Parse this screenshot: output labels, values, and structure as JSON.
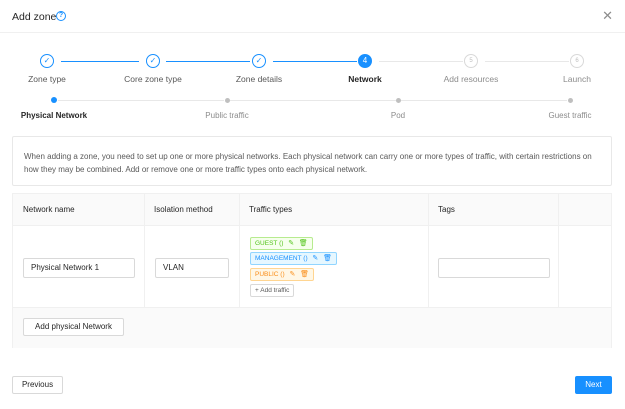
{
  "header": {
    "title": "Add zone",
    "help_icon": "question-circle-icon",
    "close_icon": "close-icon"
  },
  "steps": [
    {
      "label": "Zone type",
      "status": "done"
    },
    {
      "label": "Core zone type",
      "status": "done"
    },
    {
      "label": "Zone details",
      "status": "done"
    },
    {
      "label": "Network",
      "status": "active",
      "number": "4"
    },
    {
      "label": "Add resources",
      "status": "wait",
      "number": "5"
    },
    {
      "label": "Launch",
      "status": "wait",
      "number": "6"
    }
  ],
  "substeps": [
    {
      "label": "Physical Network",
      "status": "active"
    },
    {
      "label": "Public traffic",
      "status": "wait"
    },
    {
      "label": "Pod",
      "status": "wait"
    },
    {
      "label": "Guest traffic",
      "status": "wait"
    }
  ],
  "description": "When adding a zone, you need to set up one or more physical networks. Each physical network can carry one or more types of traffic, with certain restrictions on how they may be combined. Add or remove one or more traffic types onto each physical network.",
  "table": {
    "columns": [
      "Network name",
      "Isolation method",
      "Traffic types",
      "Tags"
    ],
    "row": {
      "network_name": "Physical Network 1",
      "isolation_method": "VLAN",
      "traffic_types": [
        "GUEST ()",
        "MANAGEMENT ()",
        "PUBLIC ()"
      ],
      "add_traffic": "Add traffic",
      "tags": ""
    },
    "add_network_label": "Add physical Network"
  },
  "footer": {
    "previous": "Previous",
    "next": "Next"
  },
  "colors": {
    "primary": "#1890ff",
    "guest": "#52c41a",
    "management": "#1890ff",
    "public": "#fa8c16"
  }
}
